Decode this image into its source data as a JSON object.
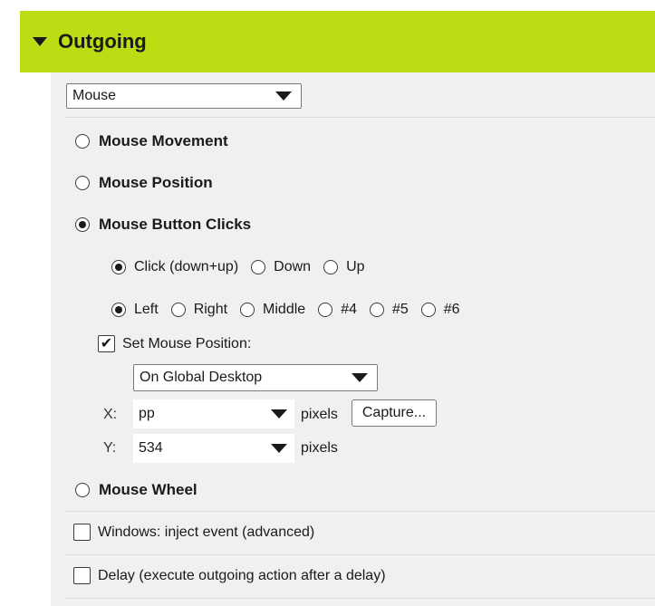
{
  "header": {
    "title": "Outgoing"
  },
  "type_select": {
    "value": "Mouse"
  },
  "modes": [
    {
      "label": "Mouse Movement",
      "selected": false
    },
    {
      "label": "Mouse Position",
      "selected": false
    },
    {
      "label": "Mouse Button Clicks",
      "selected": true
    },
    {
      "label": "Mouse Wheel",
      "selected": false
    }
  ],
  "click_type": [
    {
      "label": "Click (down+up)",
      "selected": true
    },
    {
      "label": "Down",
      "selected": false
    },
    {
      "label": "Up",
      "selected": false
    }
  ],
  "button_choice": [
    {
      "label": "Left",
      "selected": true
    },
    {
      "label": "Right",
      "selected": false
    },
    {
      "label": "Middle",
      "selected": false
    },
    {
      "label": "#4",
      "selected": false
    },
    {
      "label": "#5",
      "selected": false
    },
    {
      "label": "#6",
      "selected": false
    }
  ],
  "set_position": {
    "label": "Set Mouse Position:",
    "checked": true,
    "check_glyph": "✔",
    "coord_space": "On Global Desktop",
    "x_label": "X:",
    "x_value": "pp",
    "y_label": "Y:",
    "y_value": "534",
    "unit": "pixels",
    "capture_label": "Capture..."
  },
  "options": {
    "inject_label": "Windows: inject event (advanced)",
    "delay_label": "Delay (execute outgoing action after a delay)"
  },
  "colors": {
    "header_bg": "#bcdc14",
    "panel_bg": "#f0f0f0"
  }
}
